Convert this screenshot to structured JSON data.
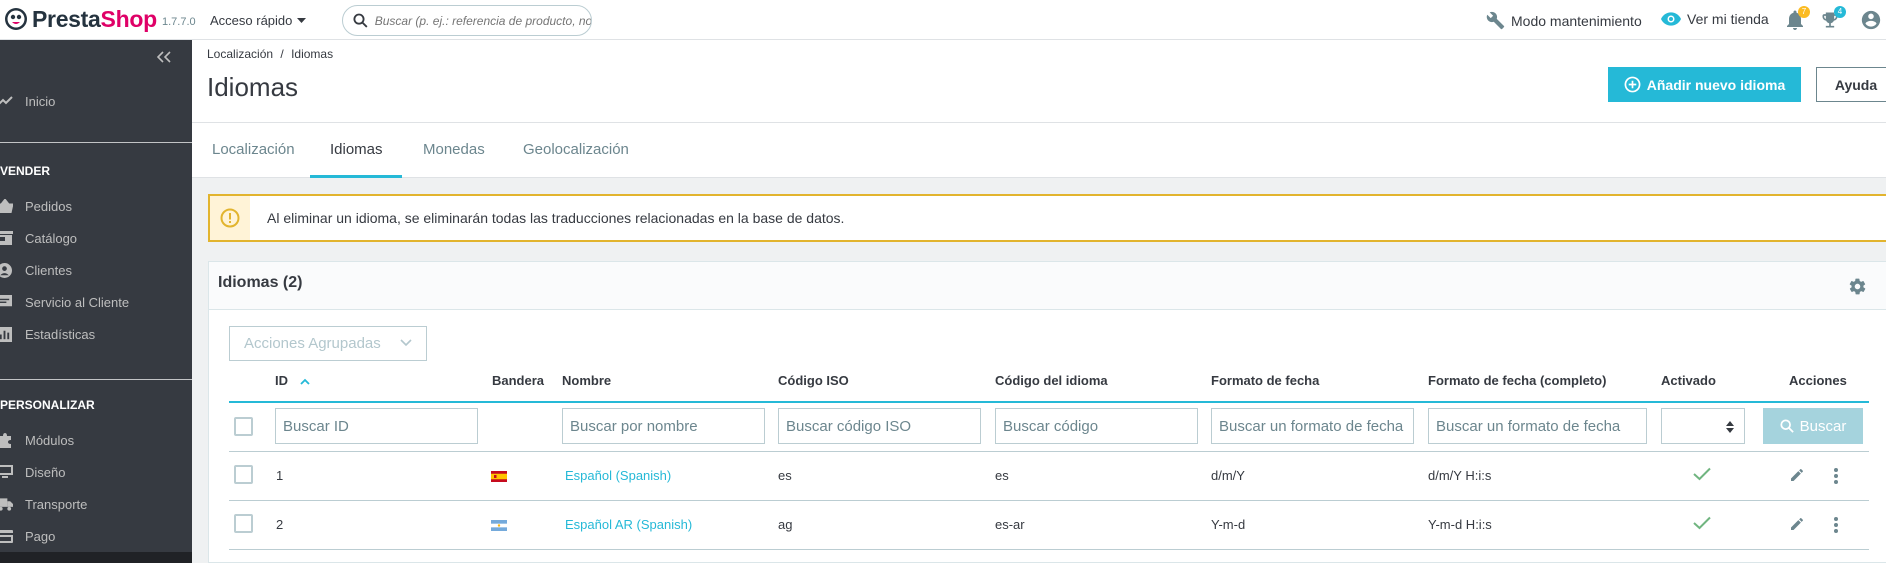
{
  "topbar": {
    "logo_presta": "Presta",
    "logo_shop": "Shop",
    "version": "1.7.7.0",
    "quick_access": "Acceso rápido",
    "search_placeholder": "Buscar (p. ej.: referencia de producto, nombre de cliente…)",
    "maintenance": "Modo mantenimiento",
    "view_shop": "Ver mi tienda",
    "notif_badge": "7",
    "orders_badge": "4",
    "colors": {
      "brand_pink": "#df0067",
      "accent": "#25b9d7",
      "badge_orange": "#fbbb22"
    }
  },
  "sidebar": {
    "items": [
      {
        "label": "Inicio",
        "icon": "trending-up-icon"
      }
    ],
    "sections": [
      {
        "title": "VENDER",
        "items": [
          {
            "label": "Pedidos",
            "icon": "shopping-basket-icon"
          },
          {
            "label": "Catálogo",
            "icon": "store-icon"
          },
          {
            "label": "Clientes",
            "icon": "account-circle-icon"
          },
          {
            "label": "Servicio al Cliente",
            "icon": "chat-icon"
          },
          {
            "label": "Estadísticas",
            "icon": "bar-chart-icon"
          }
        ]
      },
      {
        "title": "PERSONALIZAR",
        "items": [
          {
            "label": "Módulos",
            "icon": "puzzle-icon"
          },
          {
            "label": "Diseño",
            "icon": "desktop-icon"
          },
          {
            "label": "Transporte",
            "icon": "truck-icon"
          },
          {
            "label": "Pago",
            "icon": "credit-card-icon"
          }
        ]
      }
    ]
  },
  "header": {
    "breadcrumb": [
      "Localización",
      "Idiomas"
    ],
    "breadcrumb_sep": "/",
    "title": "Idiomas",
    "add_button": "Añadir nuevo idioma",
    "help_button": "Ayuda"
  },
  "tabs": [
    {
      "label": "Localización",
      "active": false
    },
    {
      "label": "Idiomas",
      "active": true
    },
    {
      "label": "Monedas",
      "active": false
    },
    {
      "label": "Geolocalización",
      "active": false
    }
  ],
  "alert": {
    "text": "Al eliminar un idioma, se eliminarán todas las traducciones relacionadas en la base de datos."
  },
  "grid": {
    "title": "Idiomas (2)",
    "bulk_actions": "Acciones Agrupadas",
    "columns": [
      "ID",
      "Bandera",
      "Nombre",
      "Código ISO",
      "Código del idioma",
      "Formato de fecha",
      "Formato de fecha (completo)",
      "Activado",
      "Acciones"
    ],
    "filters": {
      "id": "Buscar ID",
      "name": "Buscar por nombre",
      "iso": "Buscar código ISO",
      "code": "Buscar código",
      "date": "Buscar un formato de fecha",
      "date_full": "Buscar un formato de fecha",
      "search_button": "Buscar"
    },
    "rows": [
      {
        "id": "1",
        "flag": "es",
        "name": "Español (Spanish)",
        "iso": "es",
        "code": "es",
        "date": "d/m/Y",
        "date_full": "d/m/Y H:i:s",
        "active": true
      },
      {
        "id": "2",
        "flag": "ar",
        "name": "Español AR (Spanish)",
        "iso": "ag",
        "code": "es-ar",
        "date": "Y-m-d",
        "date_full": "Y-m-d H:i:s",
        "active": true
      }
    ]
  }
}
